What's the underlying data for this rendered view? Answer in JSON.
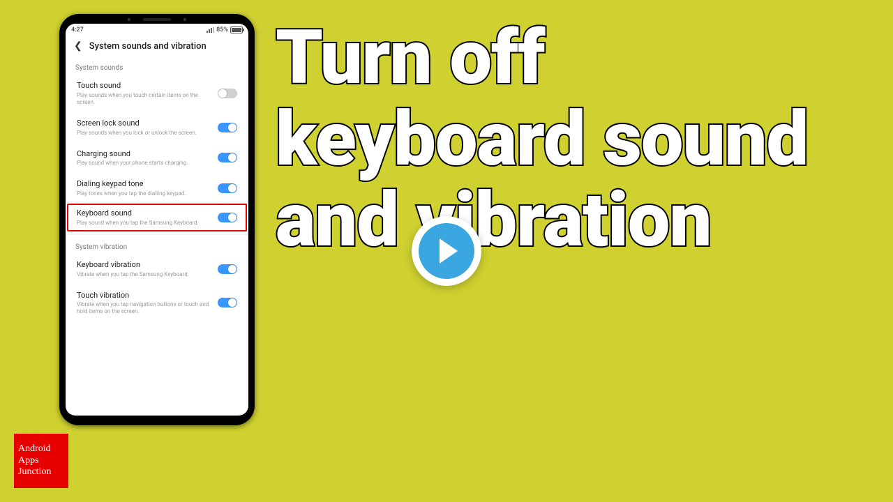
{
  "colors": {
    "bg": "#cfd130",
    "accent": "#3b97ff",
    "highlight": "#e60000",
    "play": "#3ba7e0"
  },
  "headline": "Turn off keyboard sound and vibration",
  "logo": {
    "l1": "Android",
    "l2": "Apps",
    "l3": "Junction"
  },
  "status": {
    "time": "4:27",
    "battery_pct": "85%"
  },
  "page": {
    "title": "System sounds and vibration",
    "sections": [
      {
        "label": "System sounds",
        "items": [
          {
            "title": "Touch sound",
            "sub": "Play sounds when you touch certain items on the screen.",
            "on": false,
            "highlight": false
          },
          {
            "title": "Screen lock sound",
            "sub": "Play sounds when you lock or unlock the screen.",
            "on": true,
            "highlight": false
          },
          {
            "title": "Charging sound",
            "sub": "Play sound when your phone starts charging.",
            "on": true,
            "highlight": false
          },
          {
            "title": "Dialing keypad tone",
            "sub": "Play tones when you tap the dialling keypad.",
            "on": true,
            "highlight": false
          },
          {
            "title": "Keyboard sound",
            "sub": "Play sound when you tap the Samsung Keyboard.",
            "on": true,
            "highlight": true
          }
        ]
      },
      {
        "label": "System vibration",
        "items": [
          {
            "title": "Keyboard vibration",
            "sub": "Vibrate when you tap the Samsung Keyboard.",
            "on": true,
            "highlight": false
          },
          {
            "title": "Touch vibration",
            "sub": "Vibrate when you tap navigation buttons or touch and hold items on the screen.",
            "on": true,
            "highlight": false
          }
        ]
      }
    ]
  }
}
